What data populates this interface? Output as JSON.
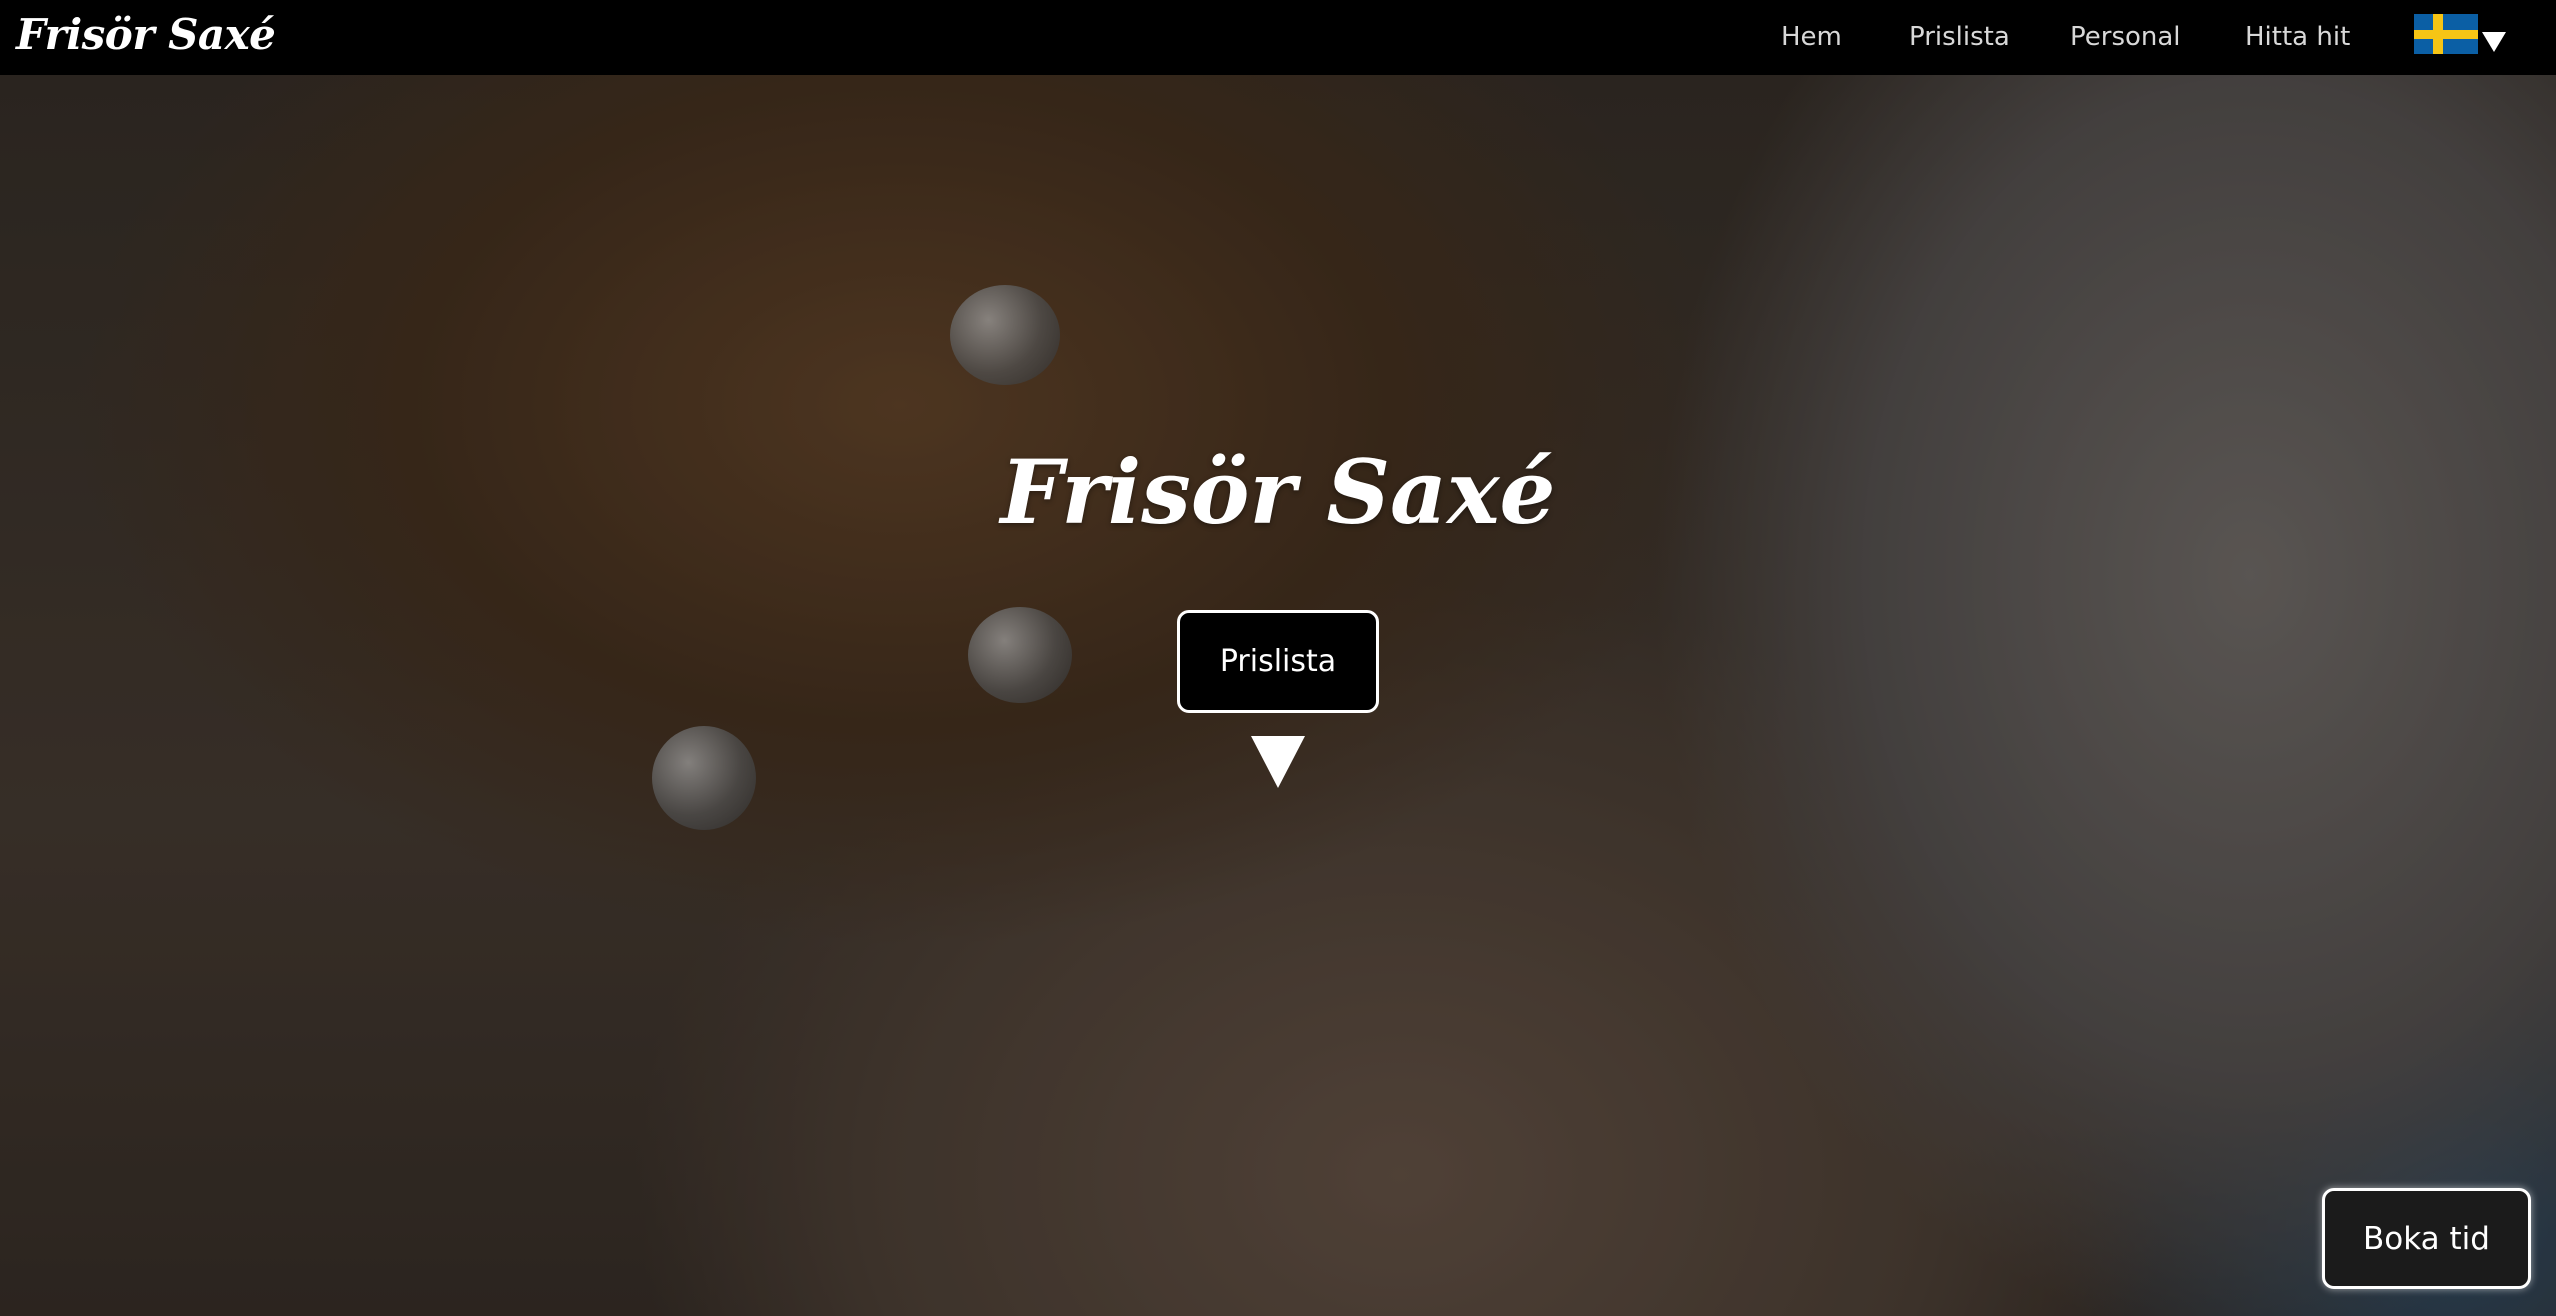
{
  "header": {
    "brand": "Frisör Saxé",
    "nav": [
      {
        "label": "Hem"
      },
      {
        "label": "Prislista"
      },
      {
        "label": "Personal"
      },
      {
        "label": "Hitta hit"
      }
    ],
    "language": {
      "icon": "swedish-flag-icon",
      "caret_icon": "chevron-down-icon"
    }
  },
  "hero": {
    "title": "Frisör Saxé",
    "price_button": "Prislista",
    "scroll_icon": "down-triangle-icon"
  },
  "booking": {
    "label": "Boka tid"
  },
  "colors": {
    "topbar": "#000000",
    "flag_blue": "#0b5fa5",
    "flag_yellow": "#f6c515",
    "button_bg": "#000000",
    "button_border": "#ffffff"
  }
}
